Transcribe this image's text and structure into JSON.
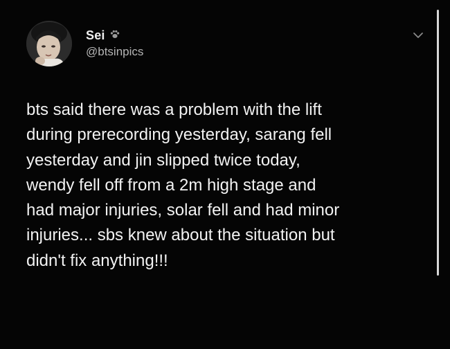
{
  "user": {
    "display_name": "Sei",
    "handle": "@btsinpics"
  },
  "tweet": {
    "lines": [
      "bts said there was a problem with the lift",
      "during prerecording yesterday, sarang fell",
      "yesterday and jin slipped twice today,",
      "wendy fell off from a 2m high stage and",
      "had major injuries, solar fell and had minor",
      "injuries... sbs knew about the situation but",
      "didn't fix anything!!!"
    ]
  },
  "icons": {
    "name_badge": "paw-icon",
    "menu": "chevron-down-icon"
  },
  "colors": {
    "background": "#050505",
    "text": "#f2f2f2",
    "handle": "#b5b5b5"
  }
}
